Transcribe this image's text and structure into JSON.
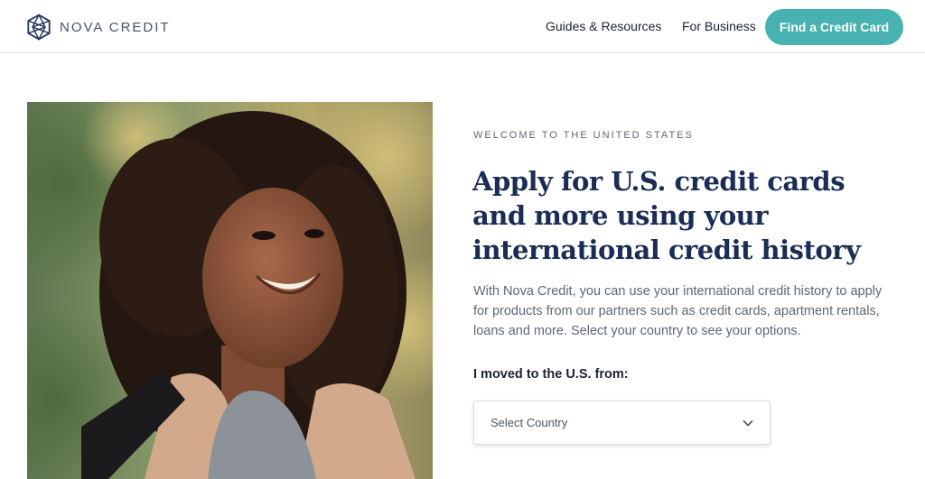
{
  "header": {
    "brand": "NOVA CREDIT",
    "nav": [
      {
        "label": "Guides & Resources"
      },
      {
        "label": "For Business"
      }
    ],
    "cta_label": "Find a Credit Card",
    "brand_color": "#47b2b0"
  },
  "hero": {
    "eyebrow": "WELCOME TO THE UNITED STATES",
    "headline": "Apply for U.S. credit cards and more using your international credit history",
    "intro": "With Nova Credit, you can use your international credit history to apply for products from our partners such as credit cards, apartment rentals, loans and more. Select your country to see your options.",
    "select_label": "I moved to the U.S. from:",
    "select_value": "Select Country",
    "photo_icon": "woman-smiling-photo",
    "select_icon": "chevron-down-icon"
  }
}
